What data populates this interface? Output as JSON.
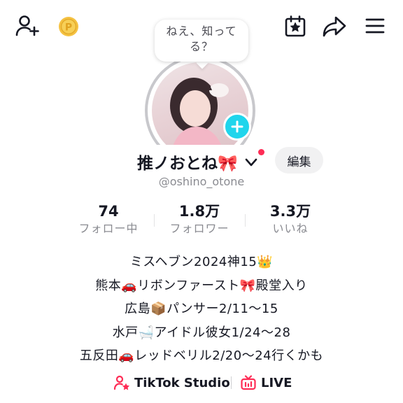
{
  "header": {
    "icons": [
      "add-friend-icon",
      "coin-icon",
      "calendar-star-icon",
      "share-icon",
      "menu-icon"
    ],
    "coin_color": "#f5c242"
  },
  "bubble": {
    "text": "ねえ、知ってる？"
  },
  "profile": {
    "name": "推ノおとね🎀",
    "username": "@oshino_otone",
    "edit_label": "編集",
    "accent_color": "#20d5ec",
    "notify_color": "#fe2c55"
  },
  "stats": [
    {
      "value": "74",
      "label": "フォロー中"
    },
    {
      "value": "1.8万",
      "label": "フォロワー"
    },
    {
      "value": "3.3万",
      "label": "いいね"
    }
  ],
  "bio": [
    "ミスヘブン2024神15👑",
    "熊本🚗リボンファースト🎀殿堂入り",
    "広島📦パンサー2/11〜15",
    "水戸🛁アイドル彼女1/24〜28",
    "五反田🚗レッドベリル2/20〜24行くかも"
  ],
  "links": [
    {
      "label": "TikTok Studio",
      "icon": "tiktok-studio-icon"
    },
    {
      "label": "LIVE",
      "icon": "live-icon"
    }
  ]
}
